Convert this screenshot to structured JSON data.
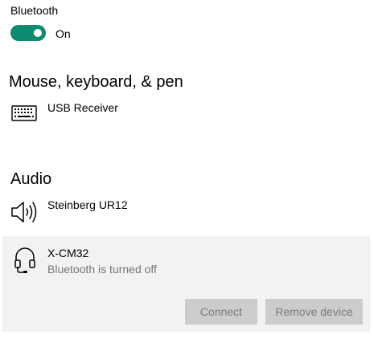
{
  "bluetooth": {
    "label": "Bluetooth",
    "toggle_state": "On",
    "toggle_color": "#0e8a72"
  },
  "sections": {
    "mouse_keyboard_pen": {
      "heading": "Mouse, keyboard, & pen",
      "devices": [
        {
          "name": "USB Receiver",
          "icon": "keyboard-icon"
        }
      ]
    },
    "audio": {
      "heading": "Audio",
      "devices": [
        {
          "name": "Steinberg UR12",
          "icon": "speaker-icon"
        },
        {
          "name": "X-CM32",
          "status": "Bluetooth is turned off",
          "icon": "headset-icon",
          "selected": true,
          "actions": {
            "connect_label": "Connect",
            "remove_label": "Remove device"
          }
        }
      ]
    }
  }
}
